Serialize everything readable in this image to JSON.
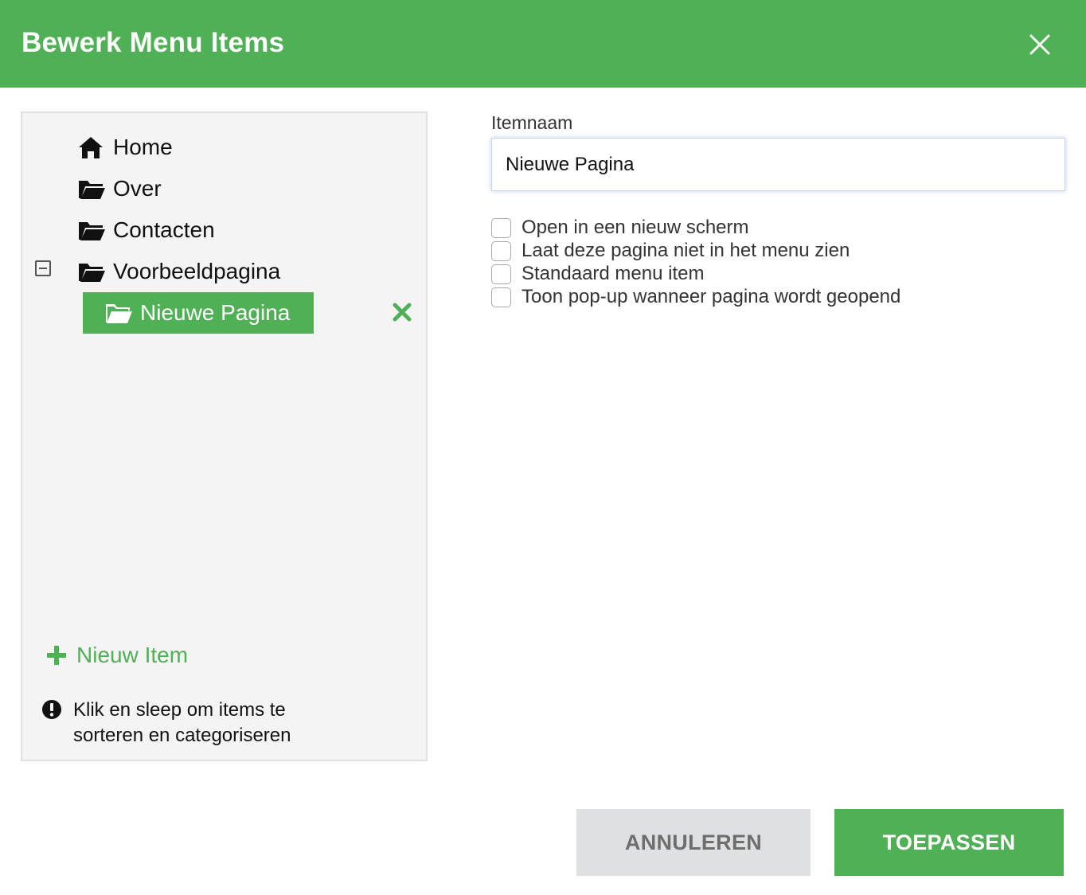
{
  "dialog": {
    "title": "Bewerk Menu Items",
    "close_icon": "close-icon"
  },
  "tree": {
    "items": [
      {
        "label": "Home",
        "icon": "home-icon"
      },
      {
        "label": "Over",
        "icon": "folder-icon"
      },
      {
        "label": "Contacten",
        "icon": "folder-icon"
      },
      {
        "label": "Voorbeeldpagina",
        "icon": "folder-icon",
        "expanded": true
      },
      {
        "label": "Nieuwe Pagina",
        "icon": "folder-open-icon",
        "selected": true
      }
    ],
    "new_item_label": "Nieuw Item",
    "hint": "Klik en sleep om items te sorteren en categoriseren"
  },
  "form": {
    "name_label": "Itemnaam",
    "name_value": "Nieuwe Pagina",
    "options": [
      {
        "label": "Open in een nieuw scherm",
        "checked": false
      },
      {
        "label": "Laat deze pagina niet in het menu zien",
        "checked": false
      },
      {
        "label": "Standaard menu item",
        "checked": false
      },
      {
        "label": "Toon pop-up wanneer pagina wordt geopend",
        "checked": false
      }
    ]
  },
  "buttons": {
    "cancel": "ANNULEREN",
    "apply": "TOEPASSEN"
  },
  "colors": {
    "accent": "#50b055",
    "panel_bg": "#f4f4f4",
    "cancel_bg": "#dfe0e2"
  }
}
